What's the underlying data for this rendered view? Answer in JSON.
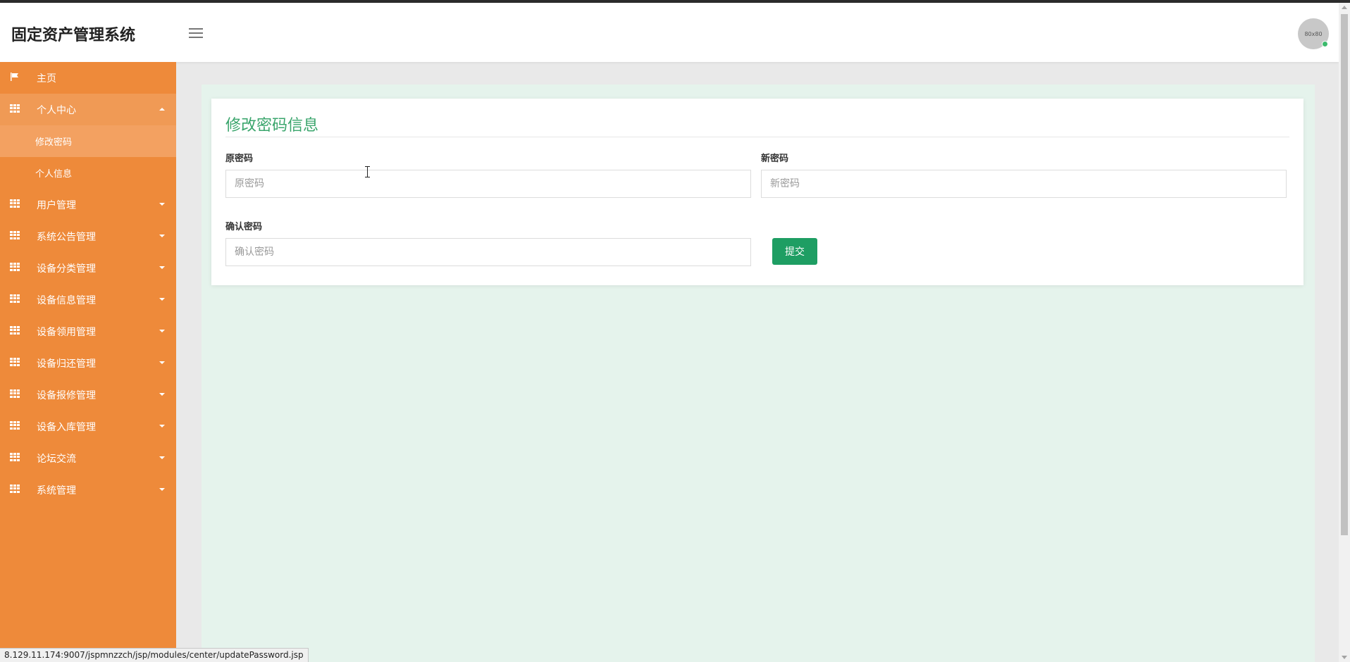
{
  "app": {
    "title": "固定资产管理系统",
    "menu_icon": "hamburger-menu-icon"
  },
  "user": {
    "avatar_text": "80x80",
    "status_color": "#3cba6d"
  },
  "sidebar": {
    "background": "#ee8a3a",
    "items": [
      {
        "label": "主页",
        "icon": "flag-icon"
      },
      {
        "label": "个人中心",
        "icon": "grid-icon",
        "expanded": true
      },
      {
        "label": "用户管理",
        "icon": "grid-icon"
      },
      {
        "label": "系统公告管理",
        "icon": "grid-icon"
      },
      {
        "label": "设备分类管理",
        "icon": "grid-icon"
      },
      {
        "label": "设备信息管理",
        "icon": "grid-icon"
      },
      {
        "label": "设备领用管理",
        "icon": "grid-icon"
      },
      {
        "label": "设备归还管理",
        "icon": "grid-icon"
      },
      {
        "label": "设备报修管理",
        "icon": "grid-icon"
      },
      {
        "label": "设备入库管理",
        "icon": "grid-icon"
      },
      {
        "label": "论坛交流",
        "icon": "grid-icon"
      },
      {
        "label": "系统管理",
        "icon": "grid-icon"
      }
    ],
    "subitems": [
      {
        "label": "修改密码",
        "active": true
      },
      {
        "label": "个人信息",
        "active": false
      }
    ]
  },
  "form": {
    "title": "修改密码信息",
    "title_color": "#3aa56c",
    "old_password": {
      "label": "原密码",
      "placeholder": "原密码"
    },
    "new_password": {
      "label": "新密码",
      "placeholder": "新密码"
    },
    "confirm_password": {
      "label": "确认密码",
      "placeholder": "确认密码"
    },
    "submit_label": "提交",
    "submit_color": "#1e9e63"
  },
  "statusbar": {
    "url": "8.129.11.174:9007/jspmnzzch/jsp/modules/center/updatePassword.jsp"
  }
}
